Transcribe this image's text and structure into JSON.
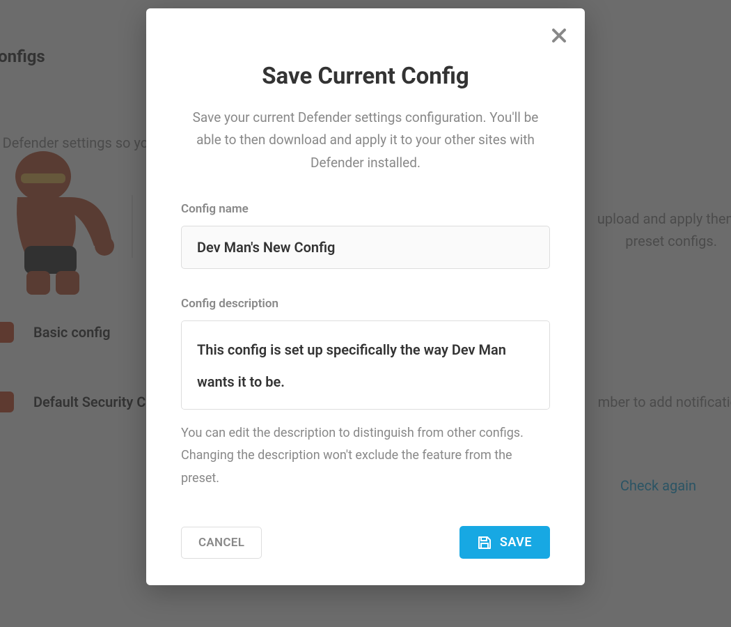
{
  "page": {
    "title": "Preset Configs",
    "subtitle": "Configs bundle your Defender settings so you can easily apply them on your other sites.",
    "info_line1": "upload and apply them",
    "info_line2": "preset configs.",
    "config_items": [
      {
        "label": "Basic config"
      },
      {
        "label": "Default Security Con"
      }
    ],
    "notification_hint": "mber to add notificatio",
    "check_again": "Check again"
  },
  "modal": {
    "title": "Save Current Config",
    "description": "Save your current Defender settings configuration. You'll be able to then download and apply it to your other sites with Defender installed.",
    "name_label": "Config name",
    "name_value": "Dev Man's New Config",
    "desc_label": "Config description",
    "desc_value": "This config is set up specifically the way Dev Man wants it to be.",
    "desc_help": "You can edit the description to distinguish from other configs. Changing the description won't exclude the feature from the preset.",
    "cancel_label": "CANCEL",
    "save_label": "SAVE"
  },
  "icons": {
    "close": "close-icon",
    "save_disk": "save-disk-icon"
  },
  "colors": {
    "accent": "#17a8e3",
    "brand_badge": "#ce4b28"
  }
}
